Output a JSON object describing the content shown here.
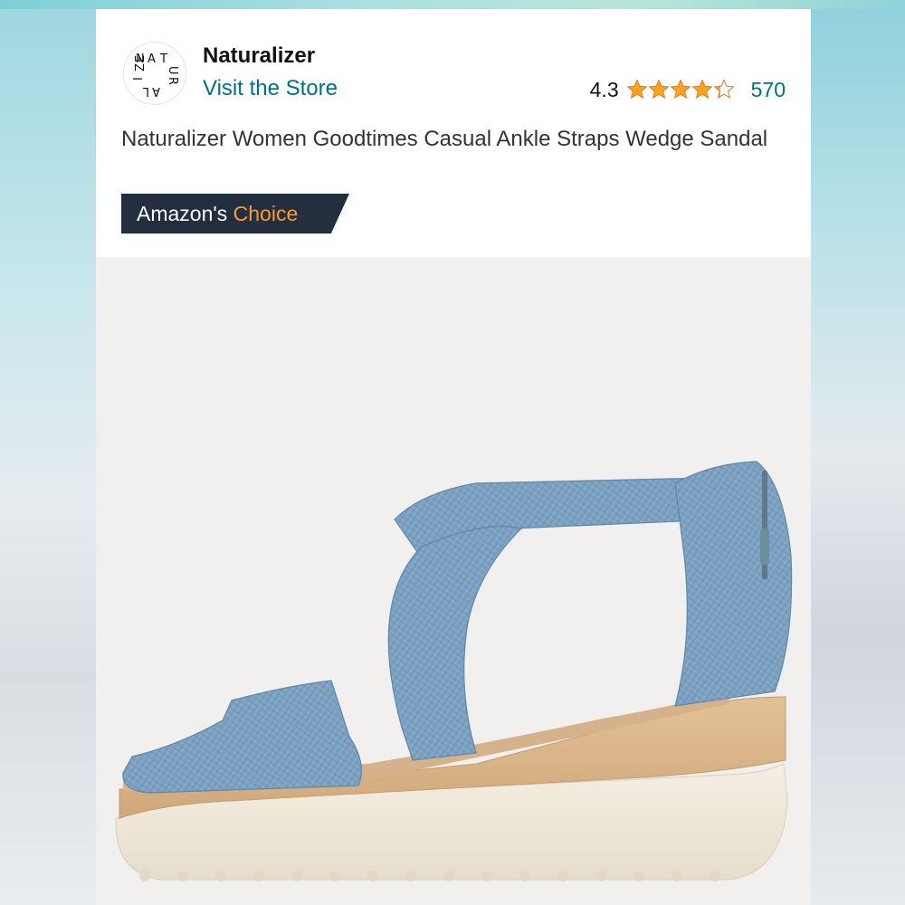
{
  "store": {
    "brand_name": "Naturalizer",
    "visit_link": "Visit the Store",
    "logo_icon": "naturalizer-logo-icon"
  },
  "rating": {
    "value": "4.3",
    "value_numeric": 4.3,
    "max": 5,
    "count": "570",
    "star_color": "#ffa41c"
  },
  "product": {
    "title": "Naturalizer Women Goodtimes Casual Ankle Straps Wedge Sandal",
    "badge_prefix": "Amazon's",
    "badge_highlight": "Choice",
    "image_icon": "wedge-sandal-image"
  },
  "colors": {
    "link": "#007185",
    "badge_bg": "#232f3e",
    "badge_accent": "#f79a33"
  }
}
